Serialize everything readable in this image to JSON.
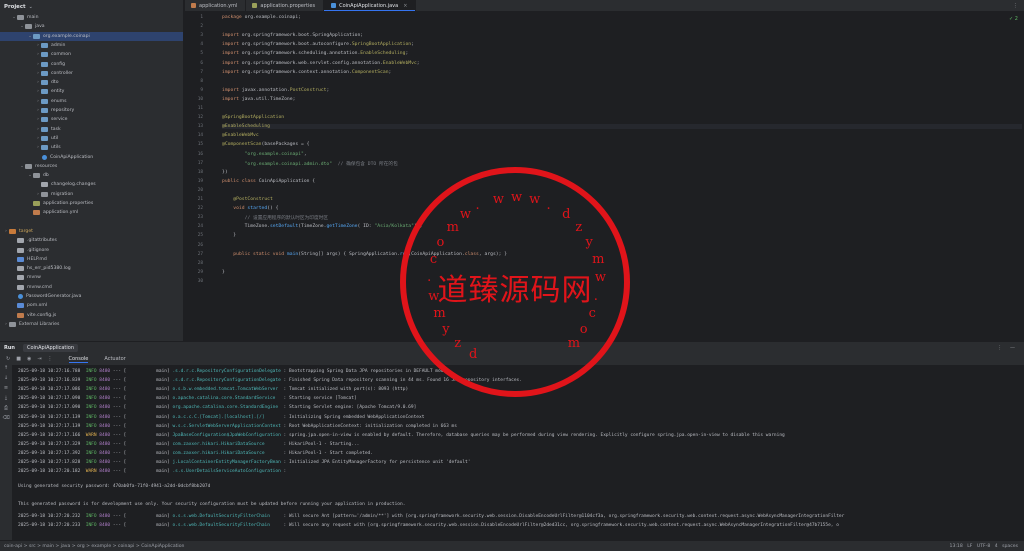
{
  "project": {
    "title": "Project",
    "rows": [
      {
        "label": "main",
        "indent": 1,
        "arrow": "v",
        "icon": "folder"
      },
      {
        "label": "java",
        "indent": 2,
        "arrow": "v",
        "icon": "folder"
      },
      {
        "label": "org.example.coinapi",
        "indent": 3,
        "arrow": "v",
        "icon": "pkg",
        "selected": true
      },
      {
        "label": "admin",
        "indent": 4,
        "arrow": ">",
        "icon": "pkg"
      },
      {
        "label": "common",
        "indent": 4,
        "arrow": ">",
        "icon": "pkg"
      },
      {
        "label": "config",
        "indent": 4,
        "arrow": ">",
        "icon": "pkg"
      },
      {
        "label": "controller",
        "indent": 4,
        "arrow": ">",
        "icon": "pkg"
      },
      {
        "label": "dto",
        "indent": 4,
        "arrow": ">",
        "icon": "pkg"
      },
      {
        "label": "entity",
        "indent": 4,
        "arrow": ">",
        "icon": "pkg"
      },
      {
        "label": "enums",
        "indent": 4,
        "arrow": ">",
        "icon": "pkg"
      },
      {
        "label": "repository",
        "indent": 4,
        "arrow": ">",
        "icon": "pkg"
      },
      {
        "label": "service",
        "indent": 4,
        "arrow": ">",
        "icon": "pkg"
      },
      {
        "label": "task",
        "indent": 4,
        "arrow": ">",
        "icon": "pkg"
      },
      {
        "label": "util",
        "indent": 4,
        "arrow": ">",
        "icon": "pkg"
      },
      {
        "label": "utils",
        "indent": 4,
        "arrow": ">",
        "icon": "pkg"
      },
      {
        "label": "CoinApiApplication",
        "indent": 4,
        "arrow": "",
        "icon": "java"
      },
      {
        "label": "resources",
        "indent": 2,
        "arrow": "v",
        "icon": "folder"
      },
      {
        "label": "db",
        "indent": 3,
        "arrow": "v",
        "icon": "folder"
      },
      {
        "label": "changelog.changes",
        "indent": 4,
        "arrow": "",
        "icon": "txt"
      },
      {
        "label": "migration",
        "indent": 4,
        "arrow": ">",
        "icon": "folder"
      },
      {
        "label": "application.properties",
        "indent": 3,
        "arrow": "",
        "icon": "prop"
      },
      {
        "label": "application.yml",
        "indent": 3,
        "arrow": "",
        "icon": "yml"
      },
      {
        "label": "",
        "indent": 0,
        "arrow": "",
        "icon": ""
      },
      {
        "label": "target",
        "indent": 0,
        "arrow": ">",
        "icon": "target",
        "excluded": true
      },
      {
        "label": ".gitattributes",
        "indent": 1,
        "arrow": "",
        "icon": "txt"
      },
      {
        "label": ".gitignore",
        "indent": 1,
        "arrow": "",
        "icon": "txt"
      },
      {
        "label": "HELP.md",
        "indent": 1,
        "arrow": "",
        "icon": "md"
      },
      {
        "label": "hs_err_pid5380.log",
        "indent": 1,
        "arrow": "",
        "icon": "txt"
      },
      {
        "label": "mvnw",
        "indent": 1,
        "arrow": "",
        "icon": "txt"
      },
      {
        "label": "mvnw.cmd",
        "indent": 1,
        "arrow": "",
        "icon": "txt"
      },
      {
        "label": "PasswordGenerator.java",
        "indent": 1,
        "arrow": "",
        "icon": "java"
      },
      {
        "label": "pom.xml",
        "indent": 1,
        "arrow": "",
        "icon": "md"
      },
      {
        "label": "vite.config.js",
        "indent": 1,
        "arrow": "",
        "icon": "yml"
      },
      {
        "label": "External Libraries",
        "indent": 0,
        "arrow": ">",
        "icon": "folder"
      }
    ]
  },
  "tabs": [
    {
      "label": "application.yml",
      "icon": "yml",
      "active": false
    },
    {
      "label": "application.properties",
      "icon": "prop",
      "active": false
    },
    {
      "label": "CoinApiApplication.java",
      "icon": "java",
      "active": true
    }
  ],
  "editor": {
    "inspection": "✓ 2",
    "lines": [
      {
        "n": "1",
        "parts": [
          [
            "kw",
            "package "
          ],
          [
            "tp",
            "org.example.coinapi;"
          ]
        ]
      },
      {
        "n": "2",
        "parts": []
      },
      {
        "n": "3",
        "parts": [
          [
            "kw",
            "import "
          ],
          [
            "tp",
            "org.springframework.boot.SpringApplication;"
          ]
        ]
      },
      {
        "n": "4",
        "parts": [
          [
            "kw",
            "import "
          ],
          [
            "tp",
            "org.springframework.boot.autoconfigure."
          ],
          [
            "an",
            "SpringBootApplication"
          ],
          [
            "tp",
            ";"
          ]
        ]
      },
      {
        "n": "5",
        "parts": [
          [
            "kw",
            "import "
          ],
          [
            "tp",
            "org.springframework.scheduling.annotation."
          ],
          [
            "an",
            "EnableScheduling"
          ],
          [
            "tp",
            ";"
          ]
        ]
      },
      {
        "n": "6",
        "parts": [
          [
            "kw",
            "import "
          ],
          [
            "tp",
            "org.springframework.web.servlet.config.annotation."
          ],
          [
            "an",
            "EnableWebMvc"
          ],
          [
            "tp",
            ";"
          ]
        ]
      },
      {
        "n": "7",
        "parts": [
          [
            "kw",
            "import "
          ],
          [
            "tp",
            "org.springframework.context.annotation."
          ],
          [
            "an",
            "ComponentScan"
          ],
          [
            "tp",
            ";"
          ]
        ]
      },
      {
        "n": "8",
        "parts": []
      },
      {
        "n": "9",
        "parts": [
          [
            "kw",
            "import "
          ],
          [
            "tp",
            "javax.annotation."
          ],
          [
            "an",
            "PostConstruct"
          ],
          [
            "tp",
            ";"
          ]
        ]
      },
      {
        "n": "10",
        "parts": [
          [
            "kw",
            "import "
          ],
          [
            "tp",
            "java.util.TimeZone;"
          ]
        ]
      },
      {
        "n": "11",
        "parts": []
      },
      {
        "n": "12",
        "parts": [
          [
            "an",
            "@SpringBootApplication"
          ]
        ]
      },
      {
        "n": "13",
        "parts": [
          [
            "an",
            "@EnableScheduling"
          ]
        ],
        "current": true
      },
      {
        "n": "14",
        "parts": [
          [
            "an",
            "@EnableWebMvc"
          ]
        ]
      },
      {
        "n": "15",
        "parts": [
          [
            "an",
            "@ComponentScan"
          ],
          [
            "tp",
            "(basePackages = {"
          ]
        ]
      },
      {
        "n": "16",
        "parts": [
          [
            "tp",
            "        "
          ],
          [
            "st",
            "\"org.example.coinapi\""
          ],
          [
            "tp",
            ","
          ]
        ]
      },
      {
        "n": "17",
        "parts": [
          [
            "tp",
            "        "
          ],
          [
            "st",
            "\"org.example.coinapi.admin.dto\""
          ],
          [
            "tp",
            "  "
          ],
          [
            "cm",
            "// 确保包含 DTO 所在的包"
          ]
        ]
      },
      {
        "n": "18",
        "parts": [
          [
            "tp",
            "})"
          ]
        ]
      },
      {
        "n": "19",
        "parts": [
          [
            "kw",
            "public class "
          ],
          [
            "tp",
            "CoinApiApplication {"
          ]
        ]
      },
      {
        "n": "20",
        "parts": []
      },
      {
        "n": "21",
        "parts": [
          [
            "tp",
            "    "
          ],
          [
            "an",
            "@PostConstruct"
          ]
        ]
      },
      {
        "n": "22",
        "parts": [
          [
            "tp",
            "    "
          ],
          [
            "kw",
            "void "
          ],
          [
            "fn",
            "started"
          ],
          [
            "tp",
            "() {"
          ]
        ]
      },
      {
        "n": "23",
        "parts": [
          [
            "tp",
            "        "
          ],
          [
            "cm",
            "// 设置应用程序的默认时区为印度时区"
          ]
        ]
      },
      {
        "n": "24",
        "parts": [
          [
            "tp",
            "        TimeZone."
          ],
          [
            "fn",
            "setDefault"
          ],
          [
            "tp",
            "(TimeZone."
          ],
          [
            "fn",
            "getTimeZone"
          ],
          [
            "tp",
            "( ID: "
          ],
          [
            "st",
            "\"Asia/Kolkata\""
          ],
          [
            "tp",
            "));"
          ]
        ]
      },
      {
        "n": "25",
        "parts": [
          [
            "tp",
            "    }"
          ]
        ]
      },
      {
        "n": "26",
        "parts": []
      },
      {
        "n": "27",
        "parts": [
          [
            "tp",
            "    "
          ],
          [
            "kw",
            "public static void "
          ],
          [
            "fn",
            "main"
          ],
          [
            "tp",
            "(String[] args) { SpringApplication."
          ],
          [
            "fn",
            "run"
          ],
          [
            "tp",
            "(CoinApiApplication."
          ],
          [
            "kw",
            "class"
          ],
          [
            "tp",
            ", args); }"
          ]
        ]
      },
      {
        "n": "28",
        "parts": []
      },
      {
        "n": "29",
        "parts": [
          [
            "tp",
            "}"
          ]
        ]
      },
      {
        "n": "30",
        "parts": []
      }
    ]
  },
  "run": {
    "label": "Run",
    "config": "CoinApiApplication",
    "tabs": [
      "Console",
      "Actuator"
    ]
  },
  "logs": [
    [
      "2025-09-18 10:27:16.788",
      "INFO",
      "8480",
      "---",
      "[           main]",
      ".s.d.r.c.RepositoryConfigurationDelegate",
      ": Bootstrapping Spring Data JPA repositories in DEFAULT mode."
    ],
    [
      "2025-09-18 10:27:16.839",
      "INFO",
      "8480",
      "---",
      "[           main]",
      ".s.d.r.c.RepositoryConfigurationDelegate",
      ": Finished Spring Data repository scanning in 44 ms. Found 16 JPA repository interfaces."
    ],
    [
      "2025-09-18 10:27:17.086",
      "INFO",
      "8480",
      "---",
      "[           main]",
      "o.s.b.w.embedded.tomcat.TomcatWebServer",
      ": Tomcat initialized with port(s): 8093 (http)"
    ],
    [
      "2025-09-18 10:27:17.090",
      "INFO",
      "8480",
      "---",
      "[           main]",
      "o.apache.catalina.core.StandardService",
      ": Starting service [Tomcat]"
    ],
    [
      "2025-09-18 10:27:17.090",
      "INFO",
      "8480",
      "---",
      "[           main]",
      "org.apache.catalina.core.StandardEngine",
      ": Starting Servlet engine: [Apache Tomcat/9.0.69]"
    ],
    [
      "2025-09-18 10:27:17.139",
      "INFO",
      "8480",
      "---",
      "[           main]",
      "o.a.c.c.C.[Tomcat].[localhost].[/]",
      ": Initializing Spring embedded WebApplicationContext"
    ],
    [
      "2025-09-18 10:27:17.139",
      "INFO",
      "8480",
      "---",
      "[           main]",
      "w.s.c.ServletWebServerApplicationContext",
      ": Root WebApplicationContext: initialization completed in 663 ms"
    ],
    [
      "2025-09-18 10:27:17.166",
      "WARN",
      "8480",
      "---",
      "[           main]",
      "JpaBaseConfiguration$JpaWebConfiguration",
      ": spring.jpa.open-in-view is enabled by default. Therefore, database queries may be performed during view rendering. Explicitly configure spring.jpa.open-in-view to disable this warning"
    ],
    [
      "2025-09-18 10:27:17.329",
      "INFO",
      "8480",
      "---",
      "[           main]",
      "com.zaxxer.hikari.HikariDataSource",
      ": HikariPool-1 - Starting..."
    ],
    [
      "2025-09-18 10:27:17.392",
      "INFO",
      "8480",
      "---",
      "[           main]",
      "com.zaxxer.hikari.HikariDataSource",
      ": HikariPool-1 - Start completed."
    ],
    [
      "2025-09-18 10:27:17.828",
      "INFO",
      "8480",
      "---",
      "[           main]",
      "j.LocalContainerEntityManagerFactoryBean",
      ": Initialized JPA EntityManagerFactory for persistence unit 'default'"
    ],
    [
      "2025-09-18 10:27:20.182",
      "WARN",
      "8480",
      "---",
      "[           main]",
      ".s.s.UserDetailsServiceAutoConfiguration",
      ":"
    ]
  ],
  "plain": [
    "Using generated security password: 470ab0fa-71f0-4941-a2dd-0dcbf8bb207d",
    "This generated password is for development use only. Your security configuration must be updated before running your application in production."
  ],
  "logs2": [
    [
      "2025-09-18 10:27:20.232",
      "INFO",
      "8480",
      "---",
      "[           main]",
      "o.s.s.web.DefaultSecurityFilterChain",
      ": Will secure Ant [pattern='/admin/**'] with [org.springframework.security.web.session.DisableEncodeUrlFilter@1104cf3a, org.springframework.security.web.context.request.async.WebAsyncManagerIntegrationFilter"
    ],
    [
      "2025-09-18 10:27:20.233",
      "INFO",
      "8480",
      "---",
      "[           main]",
      "o.s.s.web.DefaultSecurityFilterChain",
      ": Will secure any request with [org.springframework.security.web.session.DisableEncodeUrlFilter@2ded31cc, org.springframework.security.web.context.request.async.WebAsyncManagerIntegrationFilter@47b7155e, o"
    ]
  ],
  "status": {
    "crumbs": "coin-api > src > main > java > org > example > coinapi > CoinApiApplication",
    "info": "13:18   LF   UTF-8   4 spaces"
  },
  "watermark": {
    "text": "道臻源码网",
    "letters": [
      "d",
      "z",
      "y",
      "m",
      "w",
      ".",
      "c",
      "o",
      "m",
      "w",
      ".",
      "w",
      "w",
      "w",
      ".",
      "d",
      "z",
      "y",
      "m",
      "w",
      ".",
      "c",
      "o",
      "m"
    ]
  }
}
